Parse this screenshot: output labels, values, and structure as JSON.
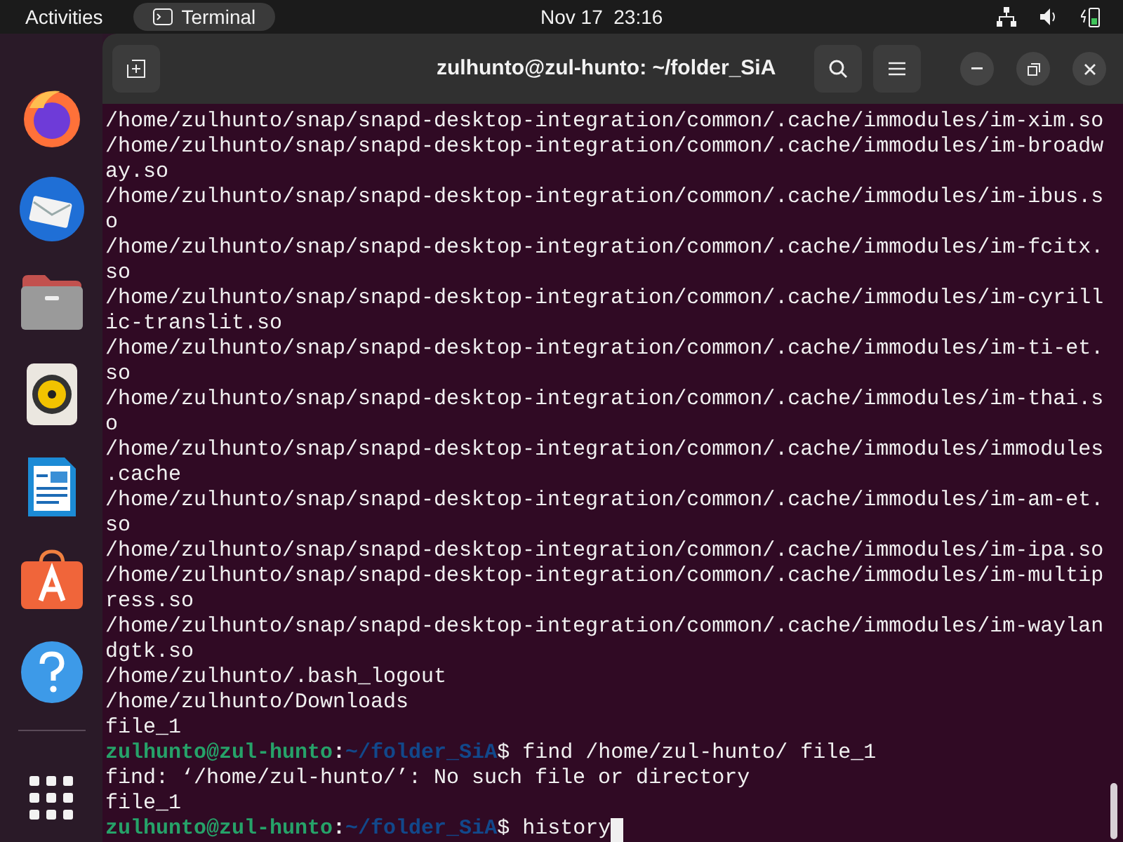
{
  "top_bar": {
    "activities": "Activities",
    "app": "Terminal",
    "clock": "Nov 17  23:16"
  },
  "dock": {
    "items": [
      {
        "kind": "firefox"
      },
      {
        "kind": "thunderbird"
      },
      {
        "kind": "files"
      },
      {
        "kind": "rhythmbox"
      },
      {
        "kind": "writer"
      },
      {
        "kind": "appcenter"
      },
      {
        "kind": "help"
      }
    ]
  },
  "window": {
    "title": "zulhunto@zul-hunto: ~/folder_SiA"
  },
  "terminal": {
    "lines": [
      {
        "kind": "output",
        "text": "/home/zulhunto/snap/snapd-desktop-integration/common/.cache/immodules/im-xim.so"
      },
      {
        "kind": "output",
        "text": "/home/zulhunto/snap/snapd-desktop-integration/common/.cache/immodules/im-broadw"
      },
      {
        "kind": "output",
        "text": "ay.so"
      },
      {
        "kind": "output",
        "text": "/home/zulhunto/snap/snapd-desktop-integration/common/.cache/immodules/im-ibus.s"
      },
      {
        "kind": "output",
        "text": "o"
      },
      {
        "kind": "output",
        "text": "/home/zulhunto/snap/snapd-desktop-integration/common/.cache/immodules/im-fcitx."
      },
      {
        "kind": "output",
        "text": "so"
      },
      {
        "kind": "output",
        "text": "/home/zulhunto/snap/snapd-desktop-integration/common/.cache/immodules/im-cyrill"
      },
      {
        "kind": "output",
        "text": "ic-translit.so"
      },
      {
        "kind": "output",
        "text": "/home/zulhunto/snap/snapd-desktop-integration/common/.cache/immodules/im-ti-et."
      },
      {
        "kind": "output",
        "text": "so"
      },
      {
        "kind": "output",
        "text": "/home/zulhunto/snap/snapd-desktop-integration/common/.cache/immodules/im-thai.s"
      },
      {
        "kind": "output",
        "text": "o"
      },
      {
        "kind": "output",
        "text": "/home/zulhunto/snap/snapd-desktop-integration/common/.cache/immodules/immodules"
      },
      {
        "kind": "output",
        "text": ".cache"
      },
      {
        "kind": "output",
        "text": "/home/zulhunto/snap/snapd-desktop-integration/common/.cache/immodules/im-am-et."
      },
      {
        "kind": "output",
        "text": "so"
      },
      {
        "kind": "output",
        "text": "/home/zulhunto/snap/snapd-desktop-integration/common/.cache/immodules/im-ipa.so"
      },
      {
        "kind": "output",
        "text": "/home/zulhunto/snap/snapd-desktop-integration/common/.cache/immodules/im-multip"
      },
      {
        "kind": "output",
        "text": "ress.so"
      },
      {
        "kind": "output",
        "text": "/home/zulhunto/snap/snapd-desktop-integration/common/.cache/immodules/im-waylan"
      },
      {
        "kind": "output",
        "text": "dgtk.so"
      },
      {
        "kind": "output",
        "text": "/home/zulhunto/.bash_logout"
      },
      {
        "kind": "output",
        "text": "/home/zulhunto/Downloads"
      },
      {
        "kind": "output",
        "text": "file_1"
      },
      {
        "kind": "prompt",
        "user_host": "zulhunto@zul-hunto",
        "separator": ":",
        "path": "~/folder_SiA",
        "symbol": "$",
        "command": "find /home/zul-hunto/ file_1",
        "cursor": false
      },
      {
        "kind": "output",
        "text": "find: ‘/home/zul-hunto/’: No such file or directory"
      },
      {
        "kind": "output",
        "text": "file_1"
      },
      {
        "kind": "prompt",
        "user_host": "zulhunto@zul-hunto",
        "separator": ":",
        "path": "~/folder_SiA",
        "symbol": "$",
        "command": "history",
        "cursor": true
      }
    ]
  }
}
